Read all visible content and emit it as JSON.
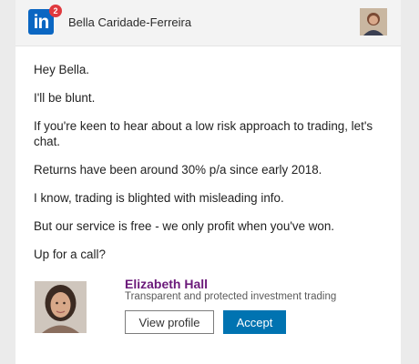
{
  "header": {
    "logo_text": "in",
    "notification_count": "2",
    "recipient_name": "Bella Caridade-Ferreira"
  },
  "message": {
    "lines": [
      "Hey Bella.",
      "I'll be blunt.",
      "If you're keen to hear about a low risk approach to trading, let's chat.",
      "Returns have been around 30% p/a since early 2018.",
      "I know, trading is blighted with misleading info.",
      "But our service is free - we only profit when you've won.",
      "Up for a call?"
    ]
  },
  "sender": {
    "name": "Elizabeth Hall",
    "tagline": "Transparent and protected investment trading"
  },
  "actions": {
    "view_profile_label": "View profile",
    "accept_label": "Accept"
  },
  "colors": {
    "linkedin_blue": "#0a66c2",
    "accept_blue": "#0073b1",
    "sender_name_purple": "#6b1a7a",
    "badge_red": "#e0393e"
  }
}
